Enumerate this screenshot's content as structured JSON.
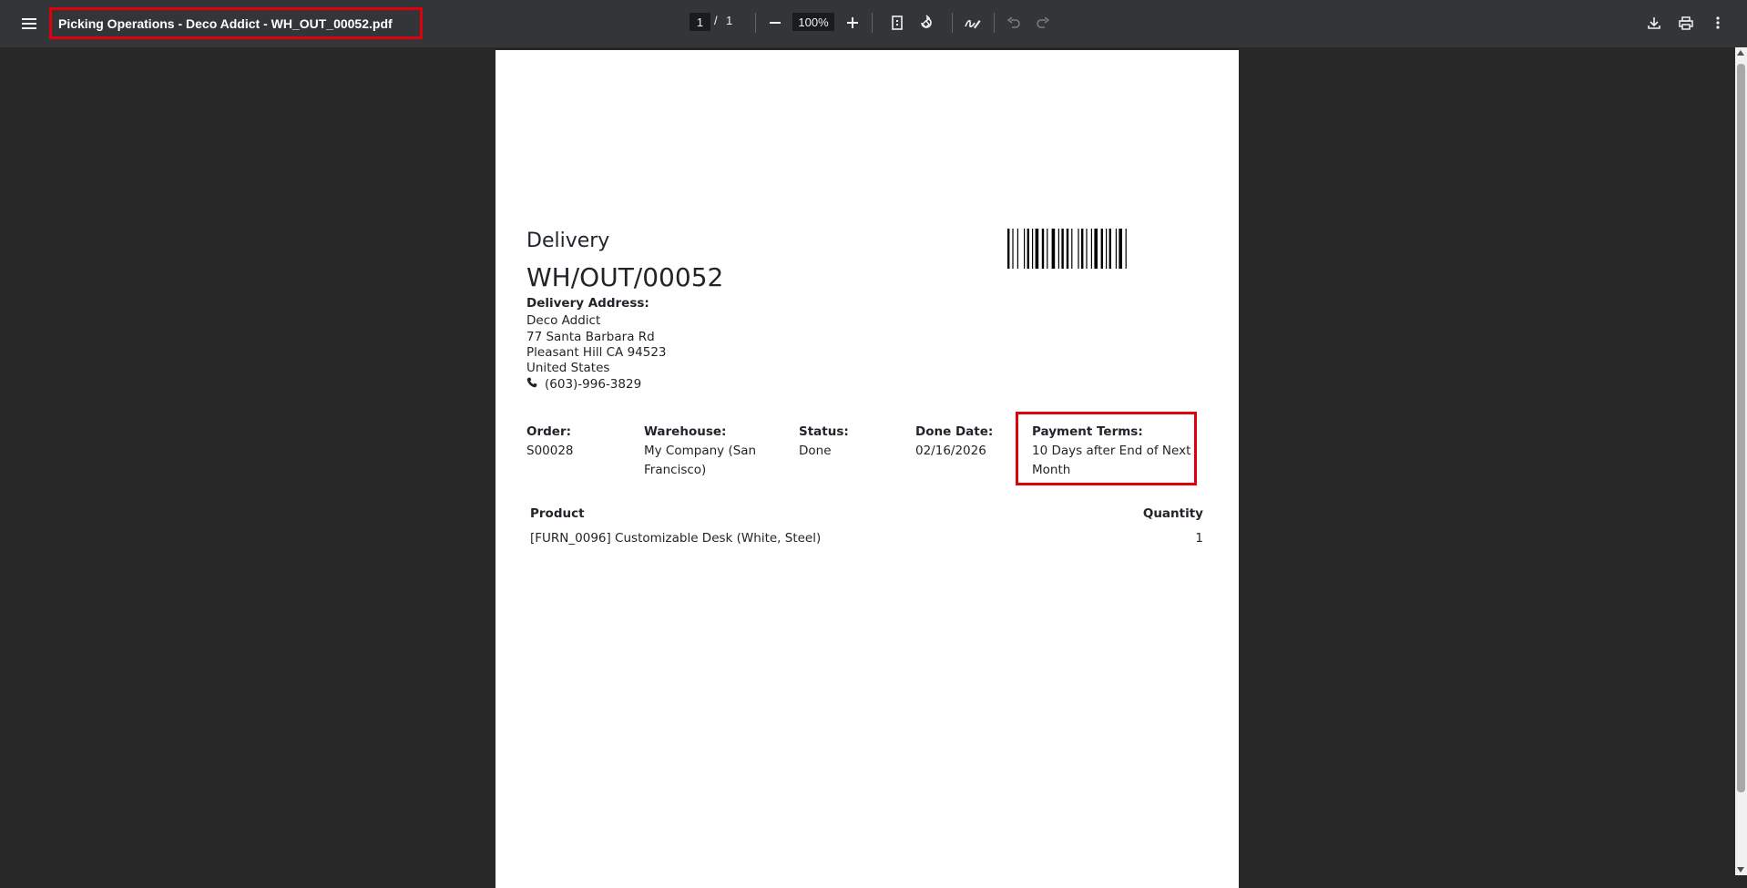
{
  "toolbar": {
    "title": "Picking Operations - Deco Addict - WH_OUT_00052.pdf",
    "page_current": "1",
    "page_separator": "/",
    "page_total": "1",
    "zoom": "100%"
  },
  "document": {
    "heading": "Delivery",
    "name": "WH/OUT/00052",
    "delivery_address_label": "Delivery Address:",
    "address": {
      "name": "Deco Addict",
      "street": "77 Santa Barbara Rd",
      "city_line": "Pleasant Hill CA 94523",
      "country": "United States",
      "phone": "(603)-996-3829"
    },
    "info": {
      "order_label": "Order:",
      "order_value": "S00028",
      "warehouse_label": "Warehouse:",
      "warehouse_value_line1": "My Company (San",
      "warehouse_value_line2": "Francisco)",
      "status_label": "Status:",
      "status_value": "Done",
      "done_date_label": "Done Date:",
      "done_date_value": "02/16/2026",
      "payment_terms_label": "Payment Terms:",
      "payment_terms_line1": "10 Days after End of Next",
      "payment_terms_line2": "Month"
    },
    "table": {
      "headers": [
        "Product",
        "Quantity"
      ],
      "rows": [
        {
          "product": "[FURN_0096] Customizable Desk (White, Steel)",
          "quantity": "1"
        }
      ]
    }
  },
  "colors": {
    "highlight": "#e0000b",
    "toolbar_bg": "#323639",
    "viewer_bg": "#282828"
  }
}
